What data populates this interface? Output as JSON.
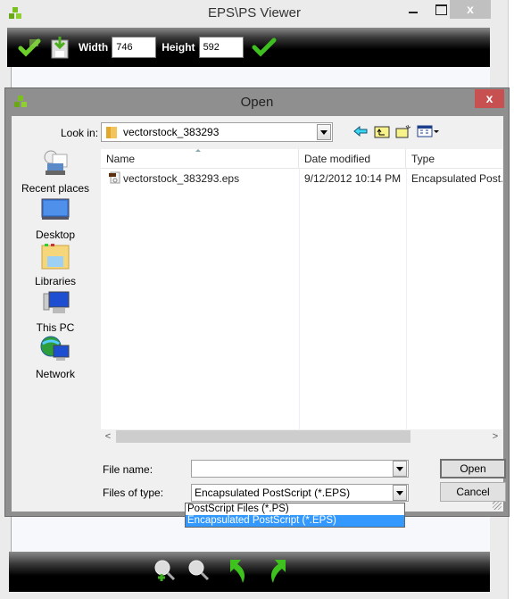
{
  "main_window": {
    "title": "EPS\\PS Viewer",
    "controls": {
      "minimize": "minimize",
      "maximize": "maximize",
      "close": "x"
    },
    "toolbar": {
      "width_label": "Width",
      "width_value": "746",
      "height_label": "Height",
      "height_value": "592",
      "icons": [
        "open-folder-icon",
        "save-icon",
        "apply-check-icon"
      ]
    },
    "bottom_toolbar": {
      "icons": [
        "zoom-in-icon",
        "zoom-out-icon",
        "rotate-left-icon",
        "rotate-right-icon"
      ]
    }
  },
  "dialog": {
    "title": "Open",
    "close_label": "x",
    "look_in_label": "Look in:",
    "look_in_value": "vectorstock_383293",
    "nav_icons": [
      "back-icon",
      "up-folder-icon",
      "new-folder-icon",
      "view-menu-icon"
    ],
    "places": [
      {
        "label": "Recent places",
        "icon": "recent-places-icon"
      },
      {
        "label": "Desktop",
        "icon": "desktop-icon"
      },
      {
        "label": "Libraries",
        "icon": "libraries-icon"
      },
      {
        "label": "This PC",
        "icon": "this-pc-icon"
      },
      {
        "label": "Network",
        "icon": "network-icon"
      }
    ],
    "columns": [
      "Name",
      "Date modified",
      "Type"
    ],
    "files": [
      {
        "name": "vectorstock_383293.eps",
        "date_modified": "9/12/2012 10:14 PM",
        "type": "Encapsulated Post..."
      }
    ],
    "file_name_label": "File name:",
    "file_name_value": "",
    "files_of_type_label": "Files of type:",
    "files_of_type_value": "Encapsulated PostScript (*.EPS)",
    "files_of_type_options": [
      "PostScript Files (*.PS)",
      "Encapsulated PostScript (*.EPS)"
    ],
    "selected_option_index": 1,
    "open_label": "Open",
    "cancel_label": "Cancel"
  },
  "colors": {
    "dialog_close": "#c75050",
    "selection": "#3399ff",
    "toolbar_bg": "#000000"
  }
}
